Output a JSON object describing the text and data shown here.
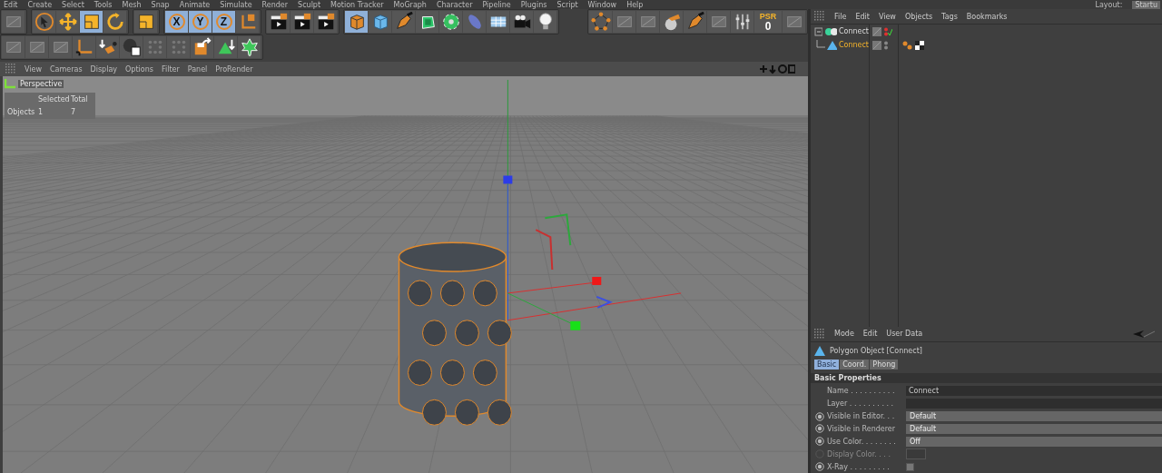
{
  "menu_bar": {
    "items": [
      "Edit",
      "Create",
      "Select",
      "Tools",
      "Mesh",
      "Snap",
      "Animate",
      "Simulate",
      "Render",
      "Sculpt",
      "Motion Tracker",
      "MoGraph",
      "Character",
      "Pipeline",
      "Plugins",
      "Script",
      "Window",
      "Help"
    ],
    "layout_label": "Layout:",
    "layout_value": "Startu"
  },
  "toolbar_top": [
    {
      "tools": [
        {
          "kind": "dim",
          "selected": false
        }
      ]
    },
    {
      "tools": [
        {
          "kind": "cursor",
          "selected": false
        },
        {
          "kind": "move",
          "selected": false
        },
        {
          "kind": "scale",
          "selected": true
        },
        {
          "kind": "rotate",
          "selected": false
        }
      ]
    },
    {
      "tools": [
        {
          "kind": "scale",
          "selected": false
        }
      ]
    },
    {
      "tools": [
        {
          "kind": "letter",
          "label": "X",
          "selected": true
        },
        {
          "kind": "letter",
          "label": "Y",
          "selected": true
        },
        {
          "kind": "letter",
          "label": "Z",
          "selected": true
        },
        {
          "kind": "axes",
          "selected": false
        }
      ]
    },
    {
      "tools": [
        {
          "kind": "clapper",
          "selected": false
        },
        {
          "kind": "clapper",
          "selected": false
        },
        {
          "kind": "clapper",
          "selected": false
        }
      ]
    },
    {
      "tools": [
        {
          "kind": "cube",
          "selected": true
        },
        {
          "kind": "bluecube",
          "selected": false
        },
        {
          "kind": "pen",
          "selected": false
        },
        {
          "kind": "gem",
          "selected": false
        },
        {
          "kind": "flower",
          "selected": false
        },
        {
          "kind": "capsule",
          "selected": false
        },
        {
          "kind": "plane",
          "selected": false
        },
        {
          "kind": "camera",
          "selected": false
        },
        {
          "kind": "bulb",
          "selected": false
        }
      ]
    }
  ],
  "toolbar_right": [
    {
      "kind": "points",
      "selected": false
    },
    {
      "kind": "dim",
      "selected": false
    },
    {
      "kind": "dim",
      "selected": false
    },
    {
      "kind": "sculpt",
      "selected": false
    },
    {
      "kind": "pen",
      "selected": false
    },
    {
      "kind": "dim",
      "selected": false
    },
    {
      "kind": "sliders",
      "selected": false
    },
    {
      "kind": "psr",
      "label": "PSR",
      "value": "0",
      "selected": false
    },
    {
      "kind": "dim",
      "selected": false
    }
  ],
  "toolbar_second": [
    {
      "tools": [
        {
          "kind": "dim",
          "selected": false
        },
        {
          "kind": "dim",
          "selected": false
        },
        {
          "kind": "dim",
          "selected": false
        },
        {
          "kind": "corner",
          "selected": false
        },
        {
          "kind": "drop",
          "selected": false
        },
        {
          "kind": "disc",
          "selected": false
        },
        {
          "kind": "dots",
          "selected": false
        },
        {
          "kind": "dots",
          "selected": false
        },
        {
          "kind": "save",
          "selected": false
        },
        {
          "kind": "triangle",
          "selected": false
        },
        {
          "kind": "leaf",
          "selected": false
        }
      ]
    }
  ],
  "viewport": {
    "menu": [
      "View",
      "Cameras",
      "Display",
      "Options",
      "Filter",
      "Panel",
      "ProRender"
    ],
    "camera_label": "Perspective",
    "hud": {
      "header_selected": "Selected",
      "header_total": "Total",
      "row_label": "Objects",
      "selected": "1",
      "total": "7"
    }
  },
  "object_manager": {
    "menu": [
      "File",
      "Edit",
      "View",
      "Objects",
      "Tags",
      "Bookmarks"
    ],
    "objects": [
      {
        "name": "Connect",
        "selected": false,
        "expanded": true,
        "children": [
          {
            "name": "Connect",
            "selected": true
          }
        ]
      }
    ]
  },
  "attribute_manager": {
    "menu": [
      "Mode",
      "Edit",
      "User Data"
    ],
    "title": "Polygon Object [Connect]",
    "tabs": [
      {
        "label": "Basic",
        "selected": true
      },
      {
        "label": "Coord.",
        "selected": false
      },
      {
        "label": "Phong",
        "selected": false
      }
    ],
    "section": "Basic Properties",
    "fields": [
      {
        "kind": "text",
        "label": "Name . . . . . . . . . .",
        "value": "Connect"
      },
      {
        "kind": "text",
        "label": "Layer . . . . . . . . . ."
      },
      {
        "kind": "dropdown",
        "label": "Visible in Editor. . .",
        "value": "Default",
        "animatable": true,
        "disabled": false
      },
      {
        "kind": "dropdown",
        "label": "Visible in Renderer",
        "value": "Default",
        "animatable": true,
        "disabled": false
      },
      {
        "kind": "dropdown",
        "label": "Use Color. . . . . . . .",
        "value": "Off",
        "animatable": true,
        "disabled": false
      },
      {
        "kind": "color",
        "label": "Display Color. . . .",
        "animatable": true,
        "disabled": true
      },
      {
        "kind": "checkbox",
        "label": "X-Ray . . . . . . . . .",
        "checked": false,
        "animatable": true,
        "disabled": false
      }
    ]
  }
}
